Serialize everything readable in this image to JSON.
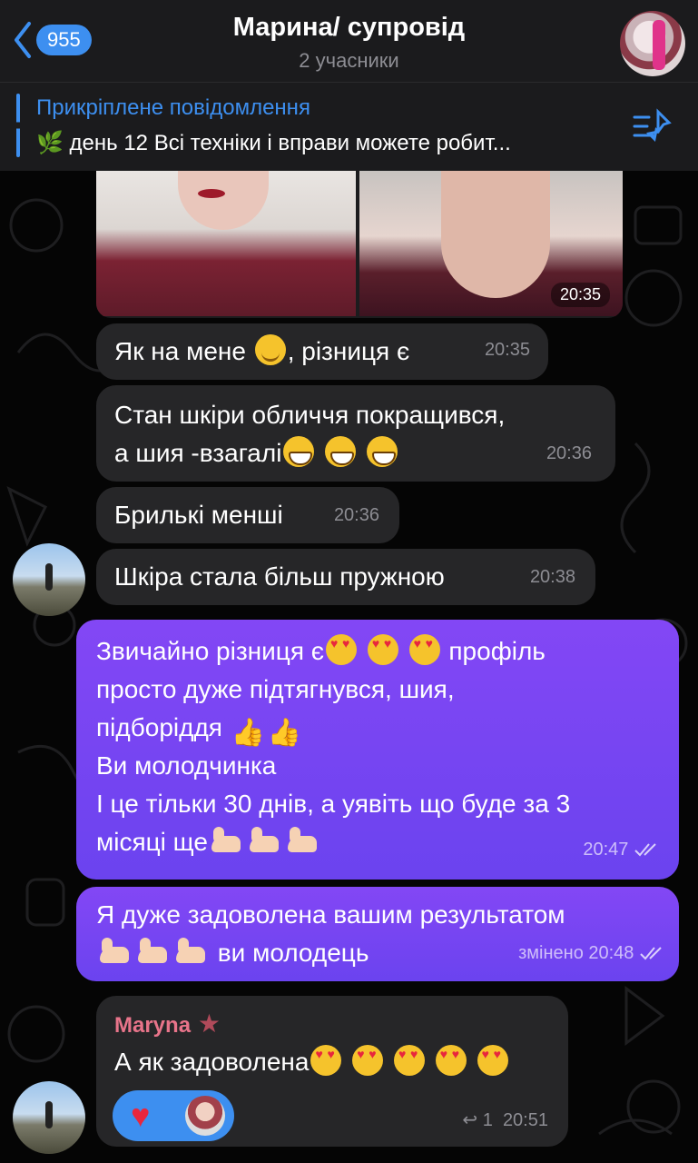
{
  "header": {
    "back_count": "955",
    "title": "Марина/ супровід",
    "subtitle": "2 учасники"
  },
  "pinned": {
    "label": "Прикріплене повідомлення",
    "text": "🌿 день 12 Всі техніки і вправи можете робит..."
  },
  "photo_message": {
    "time": "20:35"
  },
  "messages": [
    {
      "id": "m1",
      "text_a": "Як на мене",
      "text_b": ", різниця є",
      "time": "20:35"
    },
    {
      "id": "m2",
      "line1": "Стан шкіри обличчя покращився,",
      "line2": "а шия -взагалі",
      "time": "20:36"
    },
    {
      "id": "m3",
      "text": "Брилькі менші",
      "time": "20:36"
    },
    {
      "id": "m4",
      "text": "Шкіра стала більш пружною",
      "time": "20:38"
    }
  ],
  "outgoing": [
    {
      "line1_a": "Звичайно різниця є",
      "line1_b": "профіль",
      "line2": "просто дуже підтягнувся, шия,",
      "line3": "підборіддя",
      "line4": "Ви молодчинка",
      "line5": "І це тільки 30 днів, а уявіть що буде за 3",
      "line6": "місяці ще",
      "time": "20:47"
    },
    {
      "line1": "Я дуже задоволена вашим результатом",
      "line2": "ви молодець",
      "time": "змінено 20:48"
    }
  ],
  "reply_message": {
    "sender": "Maryna",
    "text": "А як задоволена",
    "reply_count": "1",
    "time": "20:51"
  },
  "colors": {
    "accent": "#3d8ff0",
    "outgoing_bubble": "#7a45f2",
    "incoming_bubble": "#262628",
    "sender_name": "#e8748a"
  }
}
